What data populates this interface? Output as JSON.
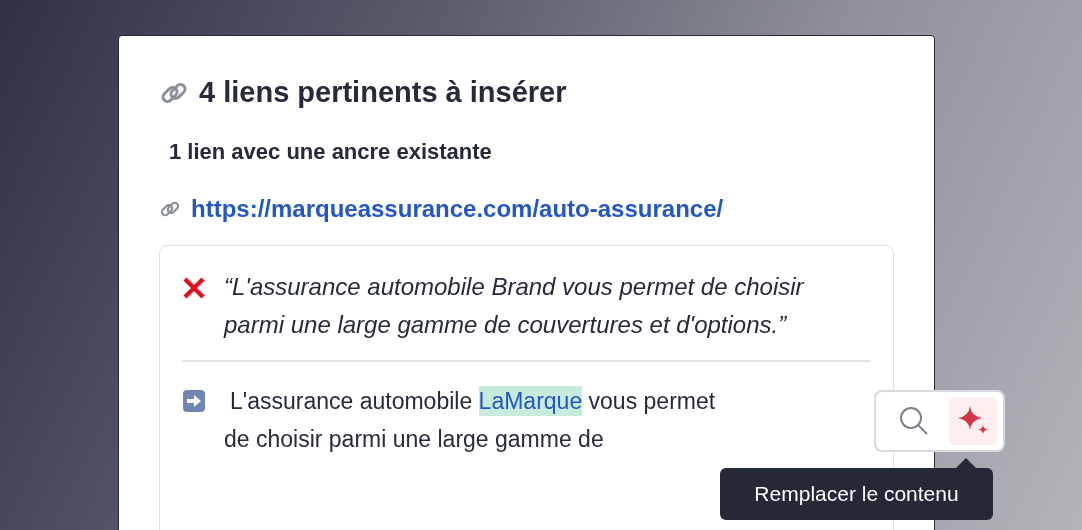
{
  "heading": "4 liens pertinents à insérer",
  "subheading": "1 lien avec une ancre existante",
  "link": "https://marqueassurance.com/auto-assurance/",
  "suggestion": {
    "original": {
      "kind": "rejected",
      "text": "“L'assurance automobile Brand vous permet de choisir parmi une large gamme de couvertures et d'options.”"
    },
    "replacement": {
      "kind": "proposed",
      "lines": [
        [
          {
            "text": "L'assurance automobile ",
            "highlighted": false
          },
          {
            "text": "LaMarque",
            "highlighted": true
          },
          {
            "text": " vous permet",
            "highlighted": false
          }
        ],
        [
          {
            "text": "de choisir parmi une large gamme de",
            "highlighted": false
          }
        ]
      ]
    }
  },
  "toolbar": [
    {
      "kind": "search",
      "selected": false
    },
    {
      "kind": "sparkle",
      "selected": true
    }
  ],
  "tooltip": "Remplacer le contenu"
}
